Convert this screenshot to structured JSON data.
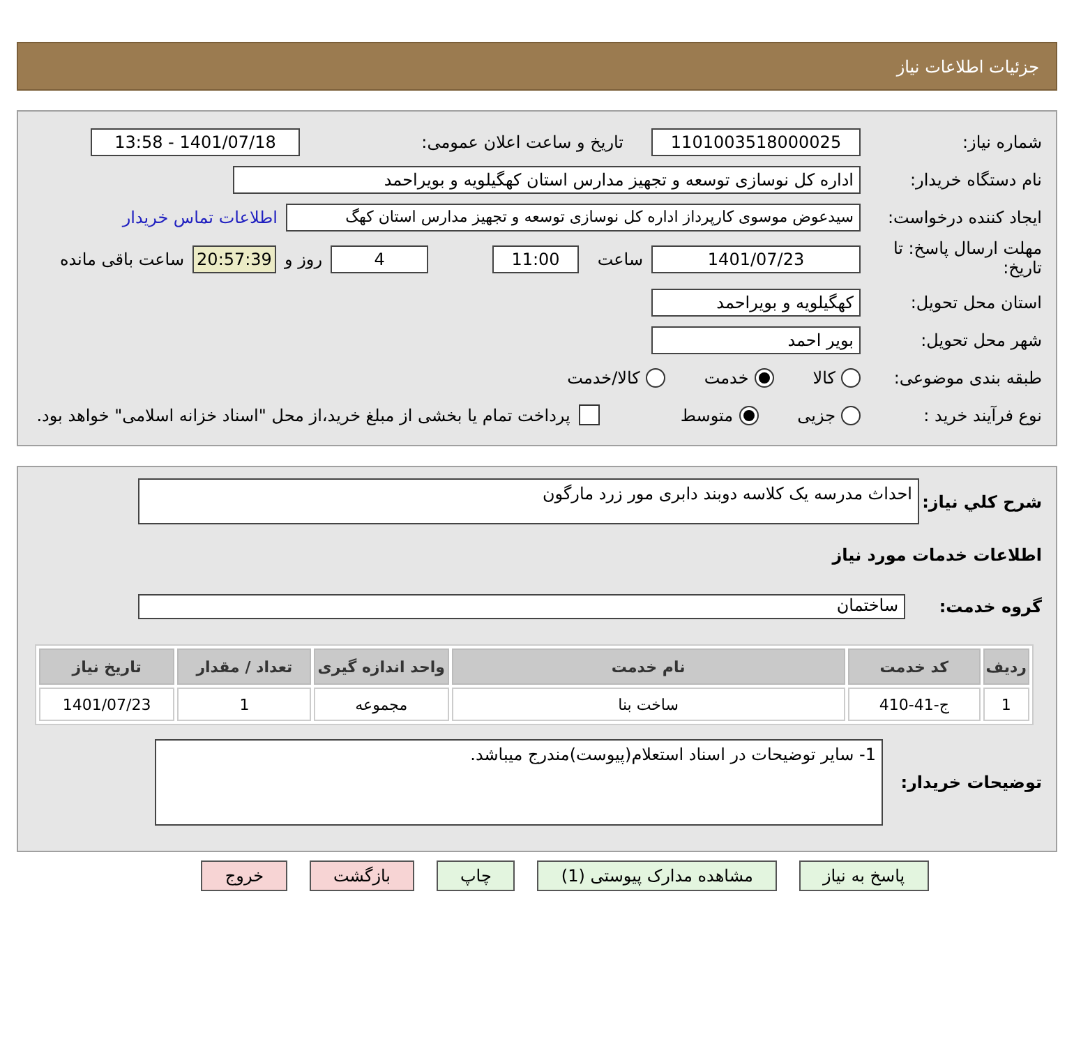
{
  "header": {
    "title": "جزئیات اطلاعات نیاز"
  },
  "details": {
    "need_number": {
      "label": "شماره نیاز:",
      "value": "1101003518000025"
    },
    "announce": {
      "label": "تاریخ و ساعت اعلان عمومی:",
      "value": "1401/07/18 - 13:58"
    },
    "buyer": {
      "label": "نام دستگاه خریدار:",
      "value": "اداره کل نوسازی  توسعه و تجهیز مدارس استان کهگیلویه و بویراحمد"
    },
    "creator": {
      "label": "ایجاد کننده درخواست:",
      "value": "سیدعوض موسوی کارپرداز اداره کل نوسازی  توسعه و تجهیز مدارس استان کهگ",
      "link": "اطلاعات تماس خریدار"
    },
    "deadline": {
      "label": "مهلت ارسال پاسخ: تا تاریخ:",
      "date": "1401/07/23",
      "time_label": "ساعت",
      "time": "11:00",
      "days": "4",
      "days_label": "روز و",
      "remaining": "20:57:39",
      "remaining_label": "ساعت باقی مانده"
    },
    "province": {
      "label": "استان محل تحویل:",
      "value": "کهگیلویه و بویراحمد"
    },
    "city": {
      "label": "شهر محل تحویل:",
      "value": "بویر احمد"
    },
    "category": {
      "label": "طبقه بندی موضوعی:",
      "options": [
        {
          "label": "کالا",
          "selected": false
        },
        {
          "label": "خدمت",
          "selected": true
        },
        {
          "label": "کالا/خدمت",
          "selected": false
        }
      ]
    },
    "process": {
      "label": "نوع فرآیند خرید :",
      "options": [
        {
          "label": "جزیی",
          "selected": false
        },
        {
          "label": "متوسط",
          "selected": true
        }
      ],
      "payment": {
        "label": "پرداخت تمام یا بخشی از مبلغ خرید،از محل \"اسناد خزانه اسلامی\" خواهد بود.",
        "checked": false
      }
    }
  },
  "services": {
    "description": {
      "label": "شرح کلي نیاز:",
      "value": "احداث مدرسه یک کلاسه دوبند دابری مور زرد مارگون"
    },
    "heading": "اطلاعات خدمات مورد نیاز",
    "group": {
      "label": "گروه خدمت:",
      "value": "ساختمان"
    },
    "table": {
      "columns": [
        "ردیف",
        "کد خدمت",
        "نام خدمت",
        "واحد اندازه گیری",
        "تعداد / مقدار",
        "تاریخ نیاز"
      ],
      "rows": [
        [
          "1",
          "ج-41-410",
          "ساخت بنا",
          "مجموعه",
          "1",
          "1401/07/23"
        ]
      ]
    },
    "notes": {
      "label": "توضیحات خریدار:",
      "value": "1- سایر توضیحات در اسناد استعلام(پیوست)مندرج میباشد."
    }
  },
  "buttons": [
    {
      "label": "پاسخ به نیاز",
      "kind": "action"
    },
    {
      "label": "مشاهده مدارک پیوستی (1)",
      "kind": "action"
    },
    {
      "label": "چاپ",
      "kind": "action"
    },
    {
      "label": "بازگشت",
      "kind": "exit"
    },
    {
      "label": "خروج",
      "kind": "exit"
    }
  ]
}
